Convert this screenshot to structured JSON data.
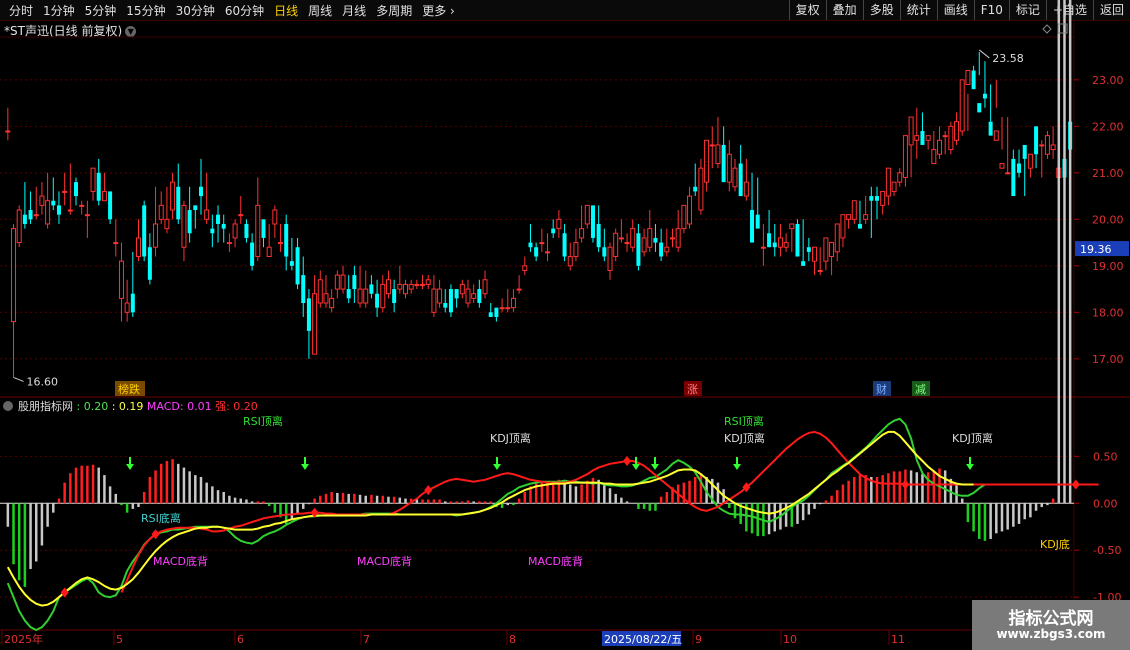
{
  "toolbar": {
    "periods": [
      "分时",
      "1分钟",
      "5分钟",
      "15分钟",
      "30分钟",
      "60分钟",
      "日线",
      "周线",
      "月线",
      "多周期",
      "更多"
    ],
    "active_period": "日线",
    "actions": [
      "复权",
      "叠加",
      "多股",
      "统计",
      "画线",
      "F10",
      "标记",
      "+自选",
      "返回"
    ]
  },
  "stock_title": "*ST声迅(日线 前复权)",
  "price_chart": {
    "y_ticks": [
      "23.00",
      "22.00",
      "21.00",
      "20.00",
      "19.00",
      "18.00",
      "17.00"
    ],
    "current_price_tag": "19.36",
    "high_label": "23.58",
    "low_label": "16.60",
    "event_markers": [
      "榜跌",
      "涨",
      "财",
      "减"
    ]
  },
  "indicator": {
    "name": "股朋指标网",
    "v1": ": 0.20",
    "v2": ": 0.19",
    "macd": "MACD: 0.01",
    "strength": "强: 0.20",
    "y_ticks": [
      "0.50",
      "0.00",
      "-0.50",
      "-1.00"
    ],
    "signals": [
      "RSI顶离",
      "KDJ顶离",
      "RSI顶离",
      "KDJ顶离",
      "KDJ顶离",
      "RSI底离",
      "MACD底背",
      "MACD底背",
      "MACD底背",
      "KDJ底"
    ]
  },
  "x_axis": {
    "labels": [
      "2025年",
      "5",
      "6",
      "7",
      "8",
      "9",
      "10",
      "11"
    ],
    "cursor_date": "2025/08/22/五"
  },
  "colors": {
    "up": "#ff3232",
    "down": "#00ffff",
    "accent": "#ffd000",
    "grid": "#3a0000"
  },
  "chart_data": {
    "type": "candlestick",
    "open": [
      21.9,
      17.8,
      19.5,
      20.1,
      20.2,
      20.1,
      20.3,
      19.9,
      20.4,
      20.3,
      20.6,
      20.2,
      20.8,
      20.3,
      20.1,
      20.6,
      21.0,
      20.4,
      20.6,
      19.5,
      18.3,
      18.0,
      18.4,
      19.2,
      20.3,
      19.4,
      19.4,
      20.0,
      19.8,
      20.2,
      20.7,
      19.4,
      20.2,
      20.3,
      20.7,
      20.0,
      19.8,
      20.1,
      19.9,
      19.5,
      19.6,
      20.1,
      19.9,
      19.5,
      19.2,
      20.0,
      19.2,
      19.9,
      19.5,
      19.9,
      19.1,
      19.4,
      18.8,
      18.3,
      17.1,
      18.2,
      18.2,
      18.1,
      18.5,
      18.5,
      18.5,
      18.8,
      18.2,
      18.2,
      18.6,
      18.4,
      18.1,
      18.4,
      18.5,
      18.5,
      18.4,
      18.5,
      18.6,
      18.6,
      18.6,
      18.0,
      18.2,
      18.2,
      18.5,
      18.5,
      18.4,
      18.2,
      18.3,
      18.5,
      18.4,
      18.0,
      18.1,
      18.1,
      18.1,
      18.1,
      18.5,
      18.9,
      19.5,
      19.4,
      19.5,
      19.3,
      19.8,
      19.8,
      19.7,
      19.0,
      19.2,
      19.6,
      19.9,
      20.3,
      19.9,
      19.4,
      18.9,
      19.2,
      19.6,
      19.5,
      19.4,
      19.7,
      19.3,
      19.4,
      19.6,
      19.5,
      19.3,
      19.6,
      19.4,
      19.8,
      19.9,
      20.7,
      20.2,
      20.8,
      21.6,
      21.2,
      21.6,
      20.8,
      20.7,
      21.2,
      20.5,
      20.2,
      20.1,
      19.4,
      19.7,
      19.5,
      19.4,
      19.4,
      19.8,
      19.9,
      19.1,
      19.4,
      19.1,
      18.9,
      19.1,
      19.2,
      19.3,
      19.6,
      20.0,
      20.0,
      19.9,
      20.0,
      20.5,
      20.5,
      20.3,
      20.5,
      20.6,
      20.8,
      20.9,
      21.6,
      21.7,
      21.9,
      21.7,
      21.2,
      21.4,
      21.8,
      21.5,
      21.7,
      21.9,
      22.9,
      23.2,
      22.5,
      22.7,
      22.1,
      21.7,
      21.1,
      21.0,
      21.3,
      21.2,
      21.6,
      21.1,
      22.0,
      21.6,
      21.4,
      21.5,
      20.9,
      21.3,
      22.1
    ],
    "close": [
      21.9,
      19.8,
      20.2,
      19.9,
      20.0,
      20.1,
      20.5,
      20.4,
      20.3,
      20.1,
      20.6,
      20.2,
      20.5,
      20.3,
      20.1,
      21.1,
      20.4,
      20.6,
      20.0,
      19.5,
      19.1,
      18.2,
      18.0,
      19.6,
      19.2,
      18.7,
      19.9,
      20.3,
      20.0,
      20.8,
      20.0,
      20.3,
      19.7,
      20.2,
      20.5,
      20.2,
      19.7,
      19.9,
      19.8,
      19.5,
      19.9,
      20.1,
      19.6,
      19.0,
      20.3,
      19.6,
      19.4,
      20.2,
      19.5,
      19.2,
      19.0,
      18.6,
      18.2,
      17.6,
      18.4,
      18.7,
      18.4,
      18.3,
      18.8,
      18.8,
      18.3,
      18.5,
      18.5,
      18.5,
      18.4,
      18.1,
      18.6,
      18.7,
      18.2,
      18.6,
      18.6,
      18.6,
      18.6,
      18.6,
      18.7,
      18.5,
      18.5,
      18.1,
      18.0,
      18.3,
      18.6,
      18.5,
      18.4,
      18.2,
      18.7,
      17.9,
      17.9,
      18.1,
      18.1,
      18.3,
      18.5,
      19.0,
      19.4,
      19.2,
      19.5,
      19.3,
      19.7,
      20.0,
      19.2,
      19.2,
      19.5,
      19.8,
      20.3,
      19.6,
      19.4,
      19.2,
      19.4,
      19.7,
      19.6,
      19.5,
      19.8,
      19.0,
      19.6,
      19.8,
      19.5,
      19.2,
      19.4,
      19.6,
      19.8,
      20.3,
      20.5,
      20.6,
      21.1,
      21.7,
      21.6,
      21.6,
      20.8,
      21.4,
      21.1,
      20.5,
      20.8,
      19.5,
      19.8,
      19.4,
      19.4,
      19.4,
      19.6,
      19.5,
      19.9,
      19.2,
      19.0,
      19.3,
      19.4,
      18.9,
      19.6,
      19.5,
      19.9,
      20.1,
      20.1,
      20.4,
      19.8,
      20.1,
      20.4,
      20.4,
      20.6,
      21.1,
      20.8,
      21.0,
      21.8,
      22.2,
      21.8,
      21.6,
      21.8,
      21.5,
      21.7,
      21.8,
      22.0,
      22.1,
      23.0,
      23.2,
      22.8,
      22.3,
      22.6,
      21.8,
      21.9,
      21.2,
      21.0,
      20.5,
      21.0,
      21.3,
      21.4,
      21.4,
      21.6,
      21.8,
      21.6,
      21.1,
      20.9,
      21.5,
      22.3
    ],
    "high": [
      22.4,
      19.9,
      20.3,
      20.8,
      20.6,
      20.7,
      20.8,
      21.0,
      20.9,
      20.6,
      21.0,
      21.2,
      20.9,
      20.4,
      20.4,
      21.1,
      21.3,
      21.0,
      20.6,
      20.0,
      19.5,
      18.7,
      19.3,
      20.0,
      20.4,
      19.7,
      20.7,
      20.6,
      20.7,
      21.0,
      21.2,
      20.4,
      20.7,
      20.3,
      21.3,
      21.0,
      20.1,
      20.3,
      20.1,
      19.7,
      20.0,
      20.5,
      20.0,
      19.7,
      20.9,
      20.0,
      19.9,
      20.3,
      19.9,
      20.1,
      19.6,
      19.6,
      19.2,
      18.5,
      18.8,
      18.9,
      18.8,
      18.5,
      18.9,
      19.0,
      18.8,
      19.0,
      19.0,
      18.9,
      18.8,
      18.7,
      18.8,
      18.9,
      18.7,
      19.0,
      18.7,
      18.7,
      18.7,
      18.8,
      18.8,
      18.8,
      18.7,
      18.5,
      18.6,
      18.5,
      18.7,
      18.7,
      18.6,
      18.7,
      18.9,
      18.2,
      18.1,
      18.3,
      18.5,
      18.5,
      18.8,
      19.2,
      19.9,
      19.5,
      19.8,
      19.7,
      20.0,
      20.2,
      19.9,
      19.5,
      19.8,
      20.3,
      20.3,
      20.3,
      20.3,
      19.8,
      19.5,
      19.8,
      20.0,
      19.7,
      20.0,
      19.9,
      19.8,
      20.2,
      19.9,
      19.8,
      19.8,
      19.8,
      20.2,
      20.3,
      20.7,
      21.2,
      21.3,
      21.2,
      22.0,
      22.2,
      22.0,
      21.7,
      21.3,
      21.6,
      21.3,
      21.0,
      20.9,
      19.9,
      20.2,
      19.9,
      19.9,
      19.7,
      19.8,
      20.0,
      20.0,
      19.6,
      19.4,
      19.4,
      19.6,
      19.3,
      19.8,
      19.9,
      20.1,
      20.2,
      20.4,
      20.5,
      20.7,
      20.7,
      20.5,
      20.6,
      20.8,
      21.1,
      21.3,
      22.1,
      22.4,
      22.3,
      21.8,
      21.9,
      22.0,
      21.9,
      22.1,
      22.3,
      22.1,
      22.7,
      23.3,
      23.6,
      23.4,
      22.9,
      23.0,
      22.2,
      22.2,
      21.5,
      21.5,
      21.3,
      21.4,
      21.6,
      21.7,
      21.9,
      22.0,
      21.9,
      21.7,
      21.7,
      21.2,
      22.4,
      22.7
    ],
    "low": [
      21.7,
      16.6,
      19.4,
      19.8,
      19.9,
      20.0,
      20.1,
      19.8,
      20.2,
      19.9,
      20.3,
      20.1,
      20.3,
      20.1,
      19.6,
      20.4,
      20.3,
      20.4,
      19.9,
      19.2,
      17.8,
      17.8,
      17.9,
      19.1,
      19.1,
      18.6,
      19.2,
      19.9,
      19.7,
      20.0,
      19.9,
      19.1,
      19.5,
      19.8,
      20.1,
      19.9,
      19.4,
      19.5,
      19.5,
      19.3,
      19.4,
      19.9,
      19.5,
      18.9,
      19.1,
      19.4,
      19.2,
      19.6,
      19.3,
      18.9,
      18.9,
      18.5,
      17.9,
      17.0,
      17.1,
      18.1,
      18.1,
      18.0,
      18.3,
      18.4,
      18.2,
      18.2,
      18.1,
      18.1,
      18.3,
      17.9,
      18.0,
      18.3,
      18.0,
      18.4,
      18.3,
      18.4,
      18.5,
      18.5,
      18.5,
      17.9,
      18.1,
      18.0,
      17.9,
      18.1,
      18.3,
      18.1,
      18.2,
      18.1,
      18.3,
      17.9,
      17.8,
      18.0,
      18.0,
      18.0,
      18.4,
      18.8,
      19.3,
      19.1,
      19.3,
      19.1,
      19.6,
      19.6,
      19.1,
      18.9,
      19.1,
      19.5,
      19.8,
      19.5,
      19.3,
      19.1,
      18.7,
      19.1,
      19.5,
      19.3,
      19.3,
      18.9,
      19.2,
      19.3,
      19.3,
      19.1,
      19.2,
      19.4,
      19.3,
      19.7,
      19.8,
      20.5,
      20.1,
      20.6,
      21.1,
      21.1,
      21.4,
      20.6,
      20.6,
      21.1,
      20.4,
      20.1,
      20.0,
      19.0,
      19.5,
      19.2,
      19.2,
      19.3,
      19.3,
      19.3,
      19.0,
      19.1,
      18.8,
      18.8,
      18.9,
      18.8,
      19.1,
      19.4,
      19.8,
      19.9,
      19.8,
      19.9,
      19.6,
      20.0,
      20.1,
      20.3,
      20.5,
      20.7,
      20.7,
      20.9,
      21.3,
      21.8,
      21.5,
      21.2,
      21.3,
      21.4,
      21.4,
      21.6,
      21.8,
      21.9,
      22.8,
      23.1,
      22.4,
      22.1,
      22.4,
      21.5,
      21.0,
      20.6,
      20.9,
      20.5,
      20.9,
      21.1,
      20.9,
      21.3,
      21.3,
      21.0,
      21.4,
      20.9,
      20.6,
      21.2,
      22.0
    ],
    "ylim": [
      16.2,
      23.9
    ]
  },
  "osc_data": {
    "ylim": [
      -1.35,
      1.1
    ],
    "hist": [
      -0.25,
      -0.65,
      -0.82,
      -0.89,
      -0.7,
      -0.62,
      -0.45,
      -0.25,
      -0.1,
      0.05,
      0.22,
      0.32,
      0.38,
      0.4,
      0.4,
      0.41,
      0.38,
      0.3,
      0.18,
      0.1,
      -0.02,
      -0.1,
      -0.06,
      -0.04,
      0.12,
      0.28,
      0.35,
      0.42,
      0.45,
      0.47,
      0.42,
      0.38,
      0.34,
      0.3,
      0.28,
      0.22,
      0.18,
      0.14,
      0.12,
      0.08,
      0.06,
      0.05,
      0.04,
      0.02,
      0.02,
      0.02,
      -0.03,
      -0.1,
      -0.15,
      -0.22,
      -0.18,
      -0.12,
      -0.06,
      -0.01,
      0.05,
      0.08,
      0.1,
      0.12,
      0.11,
      0.11,
      0.1,
      0.1,
      0.09,
      0.08,
      0.09,
      0.08,
      0.08,
      0.07,
      0.07,
      0.06,
      0.05,
      0.05,
      0.04,
      0.04,
      0.04,
      0.04,
      0.04,
      0.02,
      0.02,
      0.02,
      0.02,
      0.03,
      0.02,
      0.02,
      0.02,
      0.02,
      -0.04,
      -0.05,
      -0.02,
      -0.02,
      0.05,
      0.12,
      0.18,
      0.22,
      0.22,
      0.22,
      0.23,
      0.25,
      0.24,
      0.2,
      0.18,
      0.2,
      0.24,
      0.27,
      0.25,
      0.2,
      0.16,
      0.1,
      0.06,
      0.02,
      0.0,
      -0.06,
      -0.06,
      -0.08,
      -0.08,
      0.07,
      0.12,
      0.17,
      0.2,
      0.22,
      0.24,
      0.28,
      0.32,
      0.28,
      0.26,
      0.22,
      0.15,
      -0.05,
      -0.16,
      -0.22,
      -0.3,
      -0.32,
      -0.35,
      -0.35,
      -0.33,
      -0.3,
      -0.28,
      -0.25,
      -0.25,
      -0.22,
      -0.18,
      -0.12,
      -0.06,
      -0.01,
      0.03,
      0.08,
      0.14,
      0.2,
      0.24,
      0.28,
      0.3,
      0.3,
      0.28,
      0.28,
      0.3,
      0.32,
      0.34,
      0.34,
      0.36,
      0.35,
      0.33,
      0.31,
      0.33,
      0.35,
      0.37,
      0.35,
      0.26,
      0.2,
      0.05,
      -0.2,
      -0.3,
      -0.38,
      -0.4,
      -0.38,
      -0.32,
      -0.3,
      -0.28,
      -0.25,
      -0.22,
      -0.17,
      -0.15,
      -0.08,
      -0.04,
      -0.02,
      0.05
    ],
    "green": [
      -0.85,
      -1.0,
      -1.15,
      -1.25,
      -1.32,
      -1.35,
      -1.32,
      -1.25,
      -1.15,
      -1.0,
      -0.95,
      -0.91,
      -0.87,
      -0.83,
      -0.8,
      -0.85,
      -0.95,
      -0.99,
      -1.0,
      -0.98,
      -0.88,
      -0.72,
      -0.62,
      -0.54,
      -0.44,
      -0.38,
      -0.33,
      -0.31,
      -0.3,
      -0.28,
      -0.28,
      -0.27,
      -0.26,
      -0.25,
      -0.25,
      -0.25,
      -0.25,
      -0.25,
      -0.26,
      -0.3,
      -0.36,
      -0.4,
      -0.42,
      -0.43,
      -0.4,
      -0.35,
      -0.32,
      -0.3,
      -0.27,
      -0.23,
      -0.2,
      -0.17,
      -0.15,
      -0.14,
      -0.14,
      -0.13,
      -0.13,
      -0.12,
      -0.12,
      -0.12,
      -0.12,
      -0.12,
      -0.12,
      -0.11,
      -0.11,
      -0.11,
      -0.11,
      -0.11,
      -0.11,
      -0.12,
      -0.12,
      -0.12,
      -0.12,
      -0.12,
      -0.12,
      -0.12,
      -0.12,
      -0.12,
      -0.12,
      -0.13,
      -0.12,
      -0.11,
      -0.1,
      -0.09,
      -0.07,
      -0.04,
      0.0,
      0.05,
      0.1,
      0.13,
      0.17,
      0.19,
      0.21,
      0.22,
      0.23,
      0.23,
      0.23,
      0.23,
      0.24,
      0.23,
      0.23,
      0.22,
      0.22,
      0.21,
      0.22,
      0.2,
      0.19,
      0.19,
      0.18,
      0.18,
      0.19,
      0.21,
      0.24,
      0.27,
      0.28,
      0.32,
      0.36,
      0.42,
      0.46,
      0.43,
      0.39,
      0.33,
      0.23,
      0.12,
      0.04,
      -0.04,
      -0.08,
      -0.11,
      -0.12,
      -0.12,
      -0.13,
      -0.14,
      -0.16,
      -0.18,
      -0.2,
      -0.17,
      -0.14,
      -0.09,
      -0.04,
      0.0,
      0.03,
      0.08,
      0.14,
      0.2,
      0.25,
      0.32,
      0.36,
      0.4,
      0.44,
      0.49,
      0.54,
      0.59,
      0.65,
      0.72,
      0.78,
      0.84,
      0.88,
      0.9,
      0.84,
      0.69,
      0.46,
      0.32,
      0.25,
      0.21,
      0.18,
      0.15,
      0.12,
      0.09,
      0.08,
      0.08,
      0.11,
      0.16,
      0.2
    ],
    "yellow": [
      -0.68,
      -0.79,
      -0.89,
      -0.97,
      -1.03,
      -1.07,
      -1.09,
      -1.08,
      -1.05,
      -1.0,
      -0.95,
      -0.9,
      -0.85,
      -0.81,
      -0.79,
      -0.81,
      -0.84,
      -0.88,
      -0.91,
      -0.92,
      -0.9,
      -0.86,
      -0.81,
      -0.74,
      -0.66,
      -0.58,
      -0.51,
      -0.45,
      -0.4,
      -0.36,
      -0.33,
      -0.31,
      -0.29,
      -0.27,
      -0.26,
      -0.26,
      -0.25,
      -0.25,
      -0.26,
      -0.27,
      -0.28,
      -0.28,
      -0.28,
      -0.28,
      -0.27,
      -0.25,
      -0.24,
      -0.22,
      -0.21,
      -0.19,
      -0.17,
      -0.16,
      -0.15,
      -0.14,
      -0.13,
      -0.13,
      -0.13,
      -0.13,
      -0.13,
      -0.13,
      -0.13,
      -0.13,
      -0.13,
      -0.13,
      -0.12,
      -0.12,
      -0.12,
      -0.12,
      -0.12,
      -0.12,
      -0.12,
      -0.12,
      -0.12,
      -0.12,
      -0.12,
      -0.12,
      -0.12,
      -0.12,
      -0.12,
      -0.12,
      -0.12,
      -0.11,
      -0.1,
      -0.09,
      -0.07,
      -0.05,
      -0.02,
      0.01,
      0.05,
      0.08,
      0.11,
      0.14,
      0.16,
      0.18,
      0.19,
      0.2,
      0.21,
      0.21,
      0.21,
      0.22,
      0.22,
      0.22,
      0.22,
      0.22,
      0.22,
      0.21,
      0.21,
      0.2,
      0.2,
      0.2,
      0.2,
      0.21,
      0.22,
      0.23,
      0.25,
      0.27,
      0.29,
      0.32,
      0.35,
      0.36,
      0.36,
      0.35,
      0.31,
      0.26,
      0.2,
      0.14,
      0.08,
      0.04,
      0.0,
      -0.03,
      -0.05,
      -0.07,
      -0.09,
      -0.1,
      -0.11,
      -0.1,
      -0.08,
      -0.05,
      -0.02,
      0.02,
      0.06,
      0.1,
      0.15,
      0.2,
      0.25,
      0.3,
      0.34,
      0.39,
      0.43,
      0.48,
      0.53,
      0.58,
      0.63,
      0.68,
      0.73,
      0.76,
      0.76,
      0.72,
      0.65,
      0.58,
      0.51,
      0.45,
      0.39,
      0.34,
      0.29,
      0.26,
      0.23,
      0.21,
      0.2,
      0.2,
      0.2
    ],
    "red": [
      null,
      null,
      null,
      null,
      null,
      null,
      null,
      null,
      null,
      null,
      null,
      null,
      null,
      null,
      null,
      null,
      null,
      null,
      null,
      null,
      -0.95,
      -0.82,
      -0.68,
      -0.55,
      -0.45,
      -0.38,
      -0.33,
      -0.3,
      -0.28,
      -0.27,
      -0.26,
      -0.26,
      -0.26,
      -0.26,
      -0.27,
      -0.28,
      -0.3,
      -0.3,
      -0.29,
      -0.27,
      -0.25,
      -0.24,
      -0.22,
      -0.2,
      -0.18,
      -0.16,
      -0.15,
      -0.14,
      -0.13,
      -0.12,
      -0.12,
      -0.11,
      -0.11,
      -0.1,
      -0.1,
      -0.1,
      -0.11,
      -0.11,
      -0.12,
      -0.12,
      -0.12,
      -0.12,
      -0.12,
      -0.12,
      -0.12,
      -0.12,
      -0.12,
      -0.12,
      -0.1,
      -0.07,
      -0.03,
      0.01,
      0.05,
      0.1,
      0.14,
      0.17,
      0.2,
      0.23,
      0.25,
      0.26,
      0.25,
      0.24,
      0.23,
      0.24,
      0.25,
      0.27,
      0.29,
      0.31,
      0.32,
      0.31,
      0.29,
      0.27,
      0.25,
      0.24,
      0.23,
      0.22,
      0.22,
      0.22,
      0.22,
      0.23,
      0.25,
      0.28,
      0.31,
      0.35,
      0.38,
      0.4,
      0.42,
      0.43,
      0.44,
      0.45,
      0.45,
      0.43,
      0.4,
      0.35,
      0.3,
      0.25,
      0.2,
      0.15,
      0.1,
      0.05,
      0.0,
      -0.04,
      -0.07,
      -0.08,
      -0.06,
      -0.04,
      0.0,
      0.04,
      0.08,
      0.12,
      0.17,
      0.22,
      0.28,
      0.34,
      0.4,
      0.46,
      0.52,
      0.58,
      0.63,
      0.68,
      0.72,
      0.75,
      0.76,
      0.74,
      0.7,
      0.64,
      0.57,
      0.5,
      0.43,
      0.37,
      0.31,
      0.27,
      0.24,
      0.22,
      0.21,
      0.21,
      0.21,
      0.21,
      0.2,
      0.2,
      0.2,
      0.2,
      0.2,
      0.2,
      0.2,
      0.2,
      0.2,
      0.2,
      0.2,
      0.2,
      0.2,
      0.2,
      0.2,
      0.2,
      0.2,
      0.2,
      0.2,
      0.2,
      0.2,
      0.2,
      0.2,
      0.2,
      0.2,
      0.2,
      0.2,
      0.2,
      0.2,
      0.2,
      0.2,
      0.2,
      0.2,
      0.2,
      0.2
    ]
  }
}
